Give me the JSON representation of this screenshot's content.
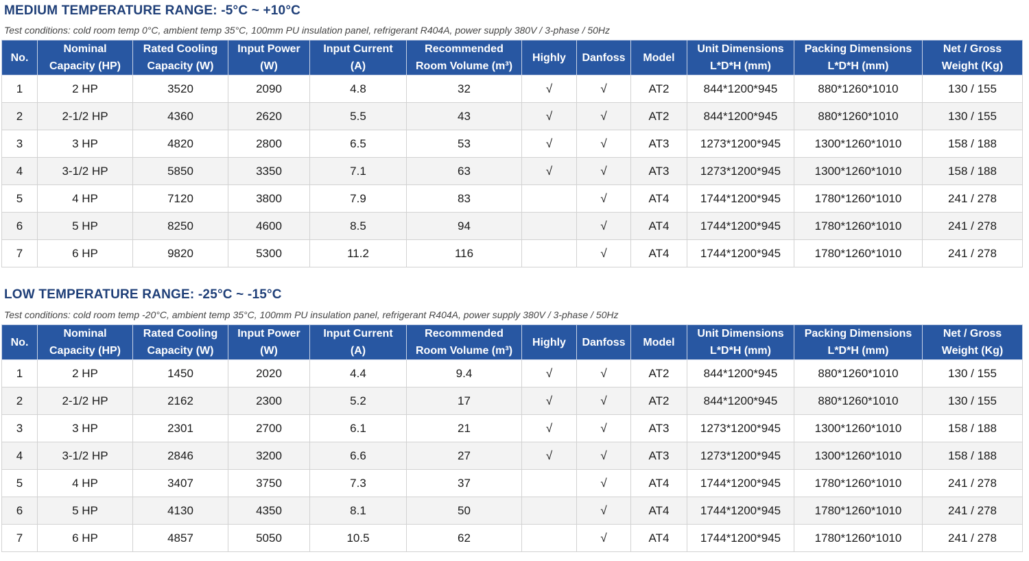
{
  "columns": [
    [
      "No.",
      ""
    ],
    [
      "Nominal",
      "Capacity (HP)"
    ],
    [
      "Rated Cooling",
      "Capacity (W)"
    ],
    [
      "Input Power",
      "(W)"
    ],
    [
      "Input Current",
      "(A)"
    ],
    [
      "Recommended",
      "Room Volume (m³)"
    ],
    [
      "Highly",
      ""
    ],
    [
      "Danfoss",
      ""
    ],
    [
      "Model",
      ""
    ],
    [
      "Unit Dimensions",
      "L*D*H (mm)"
    ],
    [
      "Packing Dimensions",
      "L*D*H (mm)"
    ],
    [
      "Net / Gross",
      "Weight (Kg)"
    ]
  ],
  "sections": [
    {
      "title": "MEDIUM TEMPERATURE RANGE: -5°C ~ +10°C",
      "conditions": "Test conditions: cold room temp 0°C, ambient temp 35°C, 100mm PU insulation panel, refrigerant R404A, power supply 380V / 3-phase / 50Hz",
      "rows": [
        [
          "1",
          "2 HP",
          "3520",
          "2090",
          "4.8",
          "32",
          "√",
          "√",
          "AT2",
          "844*1200*945",
          "880*1260*1010",
          "130 / 155"
        ],
        [
          "2",
          "2-1/2 HP",
          "4360",
          "2620",
          "5.5",
          "43",
          "√",
          "√",
          "AT2",
          "844*1200*945",
          "880*1260*1010",
          "130 / 155"
        ],
        [
          "3",
          "3 HP",
          "4820",
          "2800",
          "6.5",
          "53",
          "√",
          "√",
          "AT3",
          "1273*1200*945",
          "1300*1260*1010",
          "158 / 188"
        ],
        [
          "4",
          "3-1/2 HP",
          "5850",
          "3350",
          "7.1",
          "63",
          "√",
          "√",
          "AT3",
          "1273*1200*945",
          "1300*1260*1010",
          "158 / 188"
        ],
        [
          "5",
          "4 HP",
          "7120",
          "3800",
          "7.9",
          "83",
          "",
          "√",
          "AT4",
          "1744*1200*945",
          "1780*1260*1010",
          "241 / 278"
        ],
        [
          "6",
          "5 HP",
          "8250",
          "4600",
          "8.5",
          "94",
          "",
          "√",
          "AT4",
          "1744*1200*945",
          "1780*1260*1010",
          "241 / 278"
        ],
        [
          "7",
          "6 HP",
          "9820",
          "5300",
          "11.2",
          "116",
          "",
          "√",
          "AT4",
          "1744*1200*945",
          "1780*1260*1010",
          "241 / 278"
        ]
      ]
    },
    {
      "title": "LOW TEMPERATURE RANGE: -25°C ~ -15°C",
      "conditions": "Test conditions: cold room temp -20°C, ambient temp 35°C, 100mm PU insulation panel, refrigerant R404A, power supply 380V / 3-phase / 50Hz",
      "rows": [
        [
          "1",
          "2 HP",
          "1450",
          "2020",
          "4.4",
          "9.4",
          "√",
          "√",
          "AT2",
          "844*1200*945",
          "880*1260*1010",
          "130 / 155"
        ],
        [
          "2",
          "2-1/2 HP",
          "2162",
          "2300",
          "5.2",
          "17",
          "√",
          "√",
          "AT2",
          "844*1200*945",
          "880*1260*1010",
          "130 / 155"
        ],
        [
          "3",
          "3 HP",
          "2301",
          "2700",
          "6.1",
          "21",
          "√",
          "√",
          "AT3",
          "1273*1200*945",
          "1300*1260*1010",
          "158 / 188"
        ],
        [
          "4",
          "3-1/2 HP",
          "2846",
          "3200",
          "6.6",
          "27",
          "√",
          "√",
          "AT3",
          "1273*1200*945",
          "1300*1260*1010",
          "158 / 188"
        ],
        [
          "5",
          "4 HP",
          "3407",
          "3750",
          "7.3",
          "37",
          "",
          "√",
          "AT4",
          "1744*1200*945",
          "1780*1260*1010",
          "241 / 278"
        ],
        [
          "6",
          "5 HP",
          "4130",
          "4350",
          "8.1",
          "50",
          "",
          "√",
          "AT4",
          "1744*1200*945",
          "1780*1260*1010",
          "241 / 278"
        ],
        [
          "7",
          "6 HP",
          "4857",
          "5050",
          "10.5",
          "62",
          "",
          "√",
          "AT4",
          "1744*1200*945",
          "1780*1260*1010",
          "241 / 278"
        ]
      ]
    }
  ]
}
